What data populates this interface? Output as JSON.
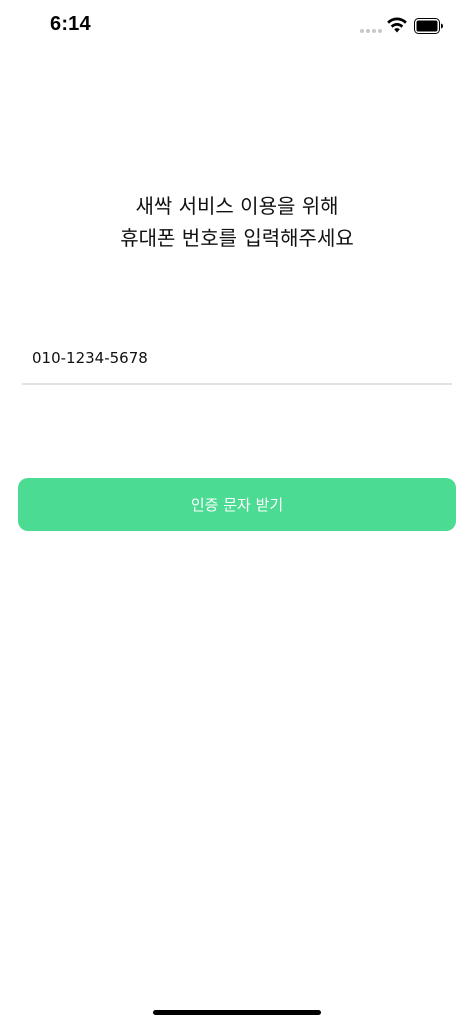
{
  "status_bar": {
    "time": "6:14",
    "signal_icon": "cellular-signal-dots",
    "wifi_icon": "wifi-icon",
    "battery_icon": "battery-icon"
  },
  "headline": {
    "line1": "새싹 서비스 이용을 위해",
    "line2": "휴대폰 번호를 입력해주세요"
  },
  "phone_field": {
    "value": "010-1234-5678",
    "placeholder": ""
  },
  "submit_button": {
    "label": "인증 문자 받기"
  },
  "colors": {
    "accent": "#4cdb92",
    "underline": "#e2e2e2",
    "text": "#111111"
  }
}
